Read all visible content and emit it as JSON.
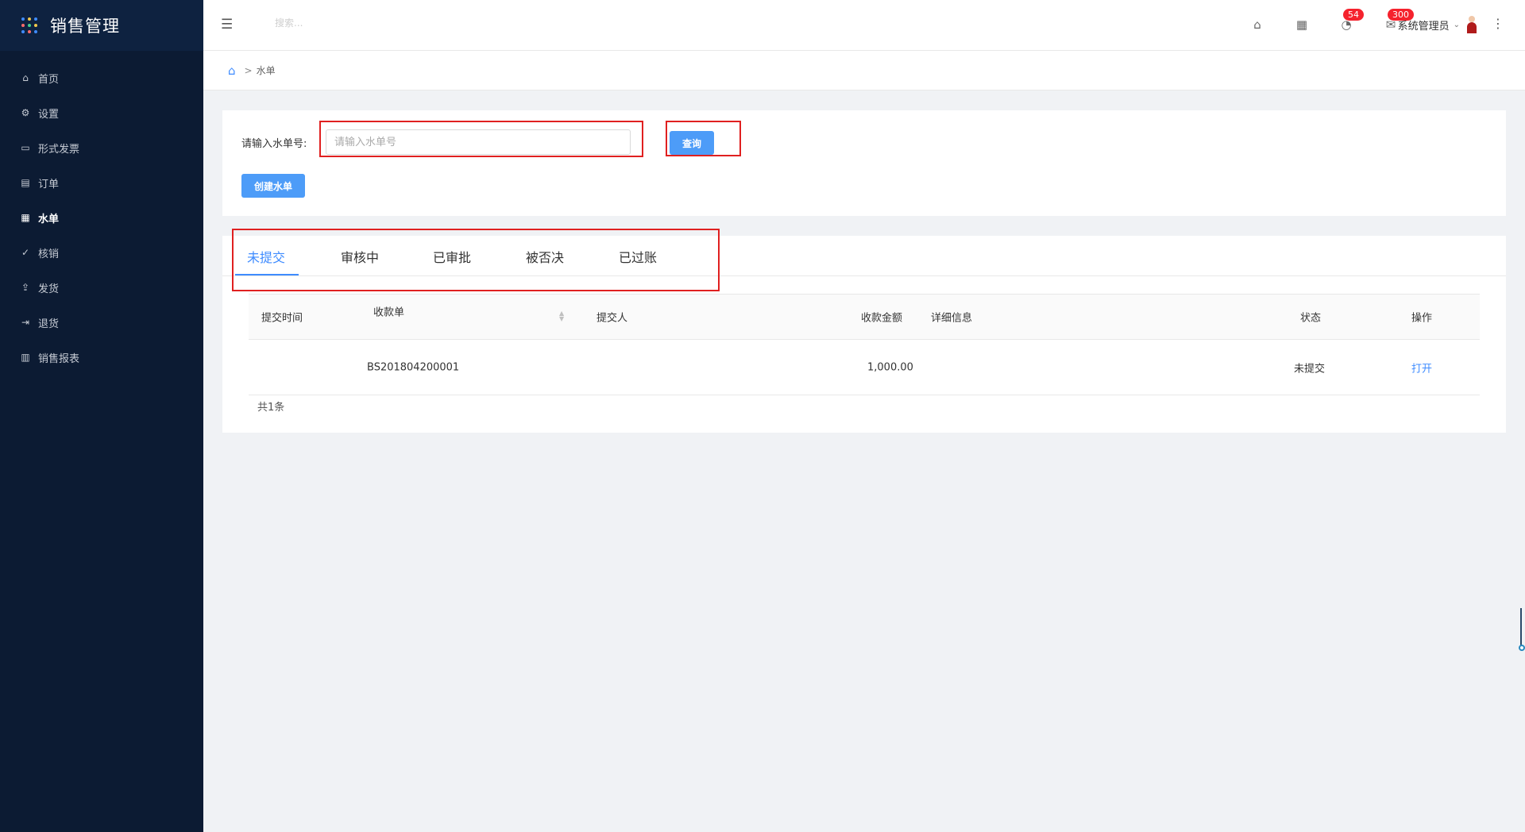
{
  "app": {
    "title": "销售管理"
  },
  "sidebar": {
    "items": [
      {
        "label": "首页",
        "icon": "home-icon",
        "glyph": "⌂"
      },
      {
        "label": "设置",
        "icon": "gear-icon",
        "glyph": "⚙"
      },
      {
        "label": "形式发票",
        "icon": "invoice-icon",
        "glyph": "▭"
      },
      {
        "label": "订单",
        "icon": "order-icon",
        "glyph": "▤"
      },
      {
        "label": "水单",
        "icon": "receipt-icon",
        "glyph": "▦"
      },
      {
        "label": "核销",
        "icon": "check-circle-icon",
        "glyph": "✓"
      },
      {
        "label": "发货",
        "icon": "upload-icon",
        "glyph": "⇪"
      },
      {
        "label": "退货",
        "icon": "logout-icon",
        "glyph": "⇥"
      },
      {
        "label": "销售报表",
        "icon": "bar-chart-icon",
        "glyph": "▥"
      }
    ],
    "active_index": 4
  },
  "header": {
    "search_placeholder": "搜索...",
    "notifications_count": "54",
    "messages_count": "300",
    "user_name": "系统管理员"
  },
  "breadcrumb": {
    "current": "水单"
  },
  "search": {
    "label": "请输入水单号:",
    "placeholder": "请输入水单号",
    "value": "",
    "query_button": "查询",
    "create_button": "创建水单"
  },
  "tabs": [
    "未提交",
    "审核中",
    "已审批",
    "被否决",
    "已过账"
  ],
  "active_tab": 0,
  "table": {
    "columns": [
      "提交时间",
      "收款单",
      "提交人",
      "收款金额",
      "详细信息",
      "状态",
      "操作"
    ],
    "rows": [
      {
        "submit_time": "",
        "receipt_no": "BS201804200001",
        "submitter": "",
        "amount": "1,000.00",
        "details": "",
        "status": "未提交",
        "action": "打开"
      }
    ],
    "total": "共1条"
  },
  "colors": {
    "accent": "#3f8cff",
    "sidebar_bg": "#0c1b33",
    "highlight": "#e02020",
    "badge": "#f5222d"
  }
}
